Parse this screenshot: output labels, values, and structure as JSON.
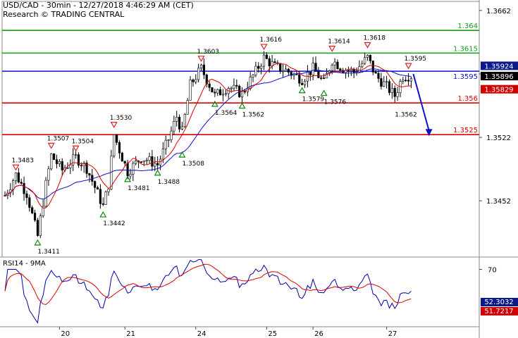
{
  "header": {
    "line1": "USD/CAD - 30min - 12/27/2018 4:46:29 AM (CET)",
    "line2": "Research © TRADING CENTRAL"
  },
  "rsi_title": "RSI14 - 9MA",
  "colors": {
    "green": "#139e13",
    "red": "#dd0000",
    "blue": "#1010cc",
    "candle": "#000000",
    "ma_red": "#dd0000",
    "ma_blue": "#1010cc",
    "marker_red": "#dd2222",
    "marker_green": "#118811",
    "rsi_blue": "#0000aa",
    "rsi_red": "#dd0000",
    "price_badge_blue": "#0a1a8a",
    "price_badge_black": "#000000",
    "price_badge_red": "#d00000"
  },
  "chart_data": {
    "type": "candlestick",
    "y_range": [
      1.339,
      1.3672
    ],
    "axis_ticks": [
      "1.3662",
      "1.3592",
      "1.3522",
      "1.3452"
    ],
    "x_labels": [
      "20",
      "21",
      "24",
      "25",
      "26",
      "27"
    ],
    "levels": [
      {
        "value": 1.364,
        "label": "1.364",
        "color": "green"
      },
      {
        "value": 1.3615,
        "label": "1.3615",
        "color": "green"
      },
      {
        "value": 1.3595,
        "label": "1.3595",
        "color": "blue"
      },
      {
        "value": 1.356,
        "label": "1.356",
        "color": "red"
      },
      {
        "value": 1.3525,
        "label": "1.3525",
        "color": "red"
      }
    ],
    "price_badges": [
      {
        "value": 1.35924,
        "label": "1.35924",
        "style": "blue"
      },
      {
        "value": 1.35896,
        "label": "1.35896",
        "style": "black"
      },
      {
        "value": 1.35829,
        "label": "1.35829",
        "style": "red"
      }
    ],
    "annotations_high": [
      {
        "bar": 4,
        "label": "1.3483"
      },
      {
        "bar": 17,
        "label": "1.3507"
      },
      {
        "bar": 26,
        "label": "1.3504"
      },
      {
        "bar": 40,
        "label": "1.3530"
      },
      {
        "bar": 72,
        "label": "1.3603"
      },
      {
        "bar": 95,
        "label": "1.3616"
      },
      {
        "bar": 120,
        "label": "1.3614"
      },
      {
        "bar": 133,
        "label": "1.3618"
      },
      {
        "bar": 148,
        "label": "1.3595"
      }
    ],
    "annotations_low": [
      {
        "bar": 12,
        "label": "1.3411"
      },
      {
        "bar": 36,
        "label": "1.3442"
      },
      {
        "bar": 45,
        "label": "1.3481"
      },
      {
        "bar": 56,
        "label": "1.3488"
      },
      {
        "bar": 65,
        "label": "1.3508"
      },
      {
        "bar": 77,
        "label": "1.3564"
      },
      {
        "bar": 87,
        "label": "1.3562"
      },
      {
        "bar": 109,
        "label": "1.3579"
      },
      {
        "bar": 117,
        "label": "1.3576"
      },
      {
        "bar": 143,
        "label": "1.3562"
      }
    ],
    "forecast": {
      "from_bar": 149,
      "from": 1.3592,
      "to_bar": 155,
      "to": 1.3525
    },
    "rsi": {
      "range": [
        20,
        80
      ],
      "level_label": "70",
      "level": 70,
      "value_rsi": "52.3032",
      "value_ma": "51.7217"
    }
  }
}
